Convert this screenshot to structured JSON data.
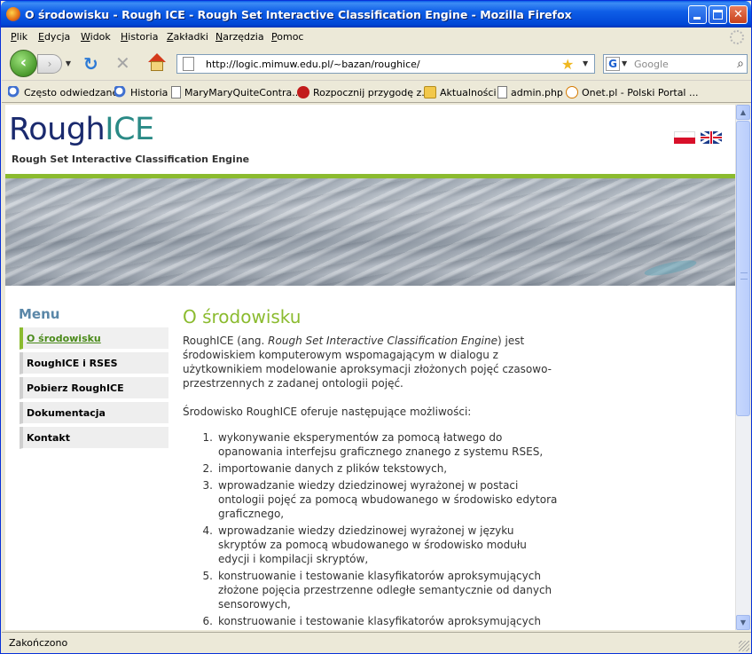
{
  "window": {
    "title": "O środowisku - Rough ICE - Rough Set Interactive Classification Engine - Mozilla Firefox"
  },
  "menubar": {
    "items": [
      "Plik",
      "Edycja",
      "Widok",
      "Historia",
      "Zakładki",
      "Narzędzia",
      "Pomoc"
    ]
  },
  "navbar": {
    "url": "http://logic.mimuw.edu.pl/~bazan/roughice/",
    "search_placeholder": "Google"
  },
  "bookmarks": [
    {
      "label": "Często odwiedzane",
      "icon": "search"
    },
    {
      "label": "Historia",
      "icon": "search"
    },
    {
      "label": "MaryMaryQuiteContra...",
      "icon": "page"
    },
    {
      "label": "Rozpocznij przygodę z...",
      "icon": "red"
    },
    {
      "label": "Aktualności",
      "icon": "folder"
    },
    {
      "label": "admin.php",
      "icon": "page"
    },
    {
      "label": "Onet.pl - Polski Portal ...",
      "icon": "onet"
    }
  ],
  "site": {
    "logo_rough": "Rough",
    "logo_ice": "ICE",
    "tagline": "Rough Set Interactive Classification Engine",
    "colors": {
      "accent_green": "#8bbb2f",
      "logo_blue": "#1a2a6e",
      "logo_teal": "#2a8a86",
      "menu_heading": "#5a87a8"
    }
  },
  "sidebar": {
    "title": "Menu",
    "items": [
      {
        "label": "O środowisku",
        "active": true
      },
      {
        "label": "RoughICE i RSES",
        "active": false
      },
      {
        "label": "Pobierz RoughICE",
        "active": false
      },
      {
        "label": "Dokumentacja",
        "active": false
      },
      {
        "label": "Kontakt",
        "active": false
      }
    ]
  },
  "content": {
    "title": "O środowisku",
    "intro_prefix": "RoughICE (ang. ",
    "intro_italic": "Rough Set Interactive Classification Engine",
    "intro_suffix": ") jest środowiskiem komputerowym wspomagającym w dialogu z użytkownikiem modelowanie aproksymacji złożonych pojęć czasowo-przestrzennych z zadanej ontologii pojęć.",
    "features_intro": "Środowisko RoughICE oferuje następujące możliwości:",
    "features": [
      {
        "num": "1.",
        "text": "wykonywanie eksperymentów za pomocą łatwego do opanowania interfejsu graficznego znanego z systemu RSES,"
      },
      {
        "num": "2.",
        "text": "importowanie danych z plików tekstowych,"
      },
      {
        "num": "3.",
        "text": "wprowadzanie wiedzy dziedzinowej wyrażonej w postaci ontologii pojęć za pomocą wbudowanego w środowisko edytora graficznego,"
      },
      {
        "num": "4.",
        "text": "wprowadzanie wiedzy dziedzinowej wyrażonej w języku skryptów za pomocą wbudowanego w środowisko modułu edycji i kompilacji skryptów,"
      },
      {
        "num": "5.",
        "text": "konstruowanie i testowanie klasyfikatorów aproksymujących złożone pojęcia przestrzenne odległe semantycznie od danych sensorowych,"
      },
      {
        "num": "6.",
        "text": "konstruowanie i testowanie klasyfikatorów aproksymujących"
      }
    ]
  },
  "statusbar": {
    "text": "Zakończono"
  }
}
